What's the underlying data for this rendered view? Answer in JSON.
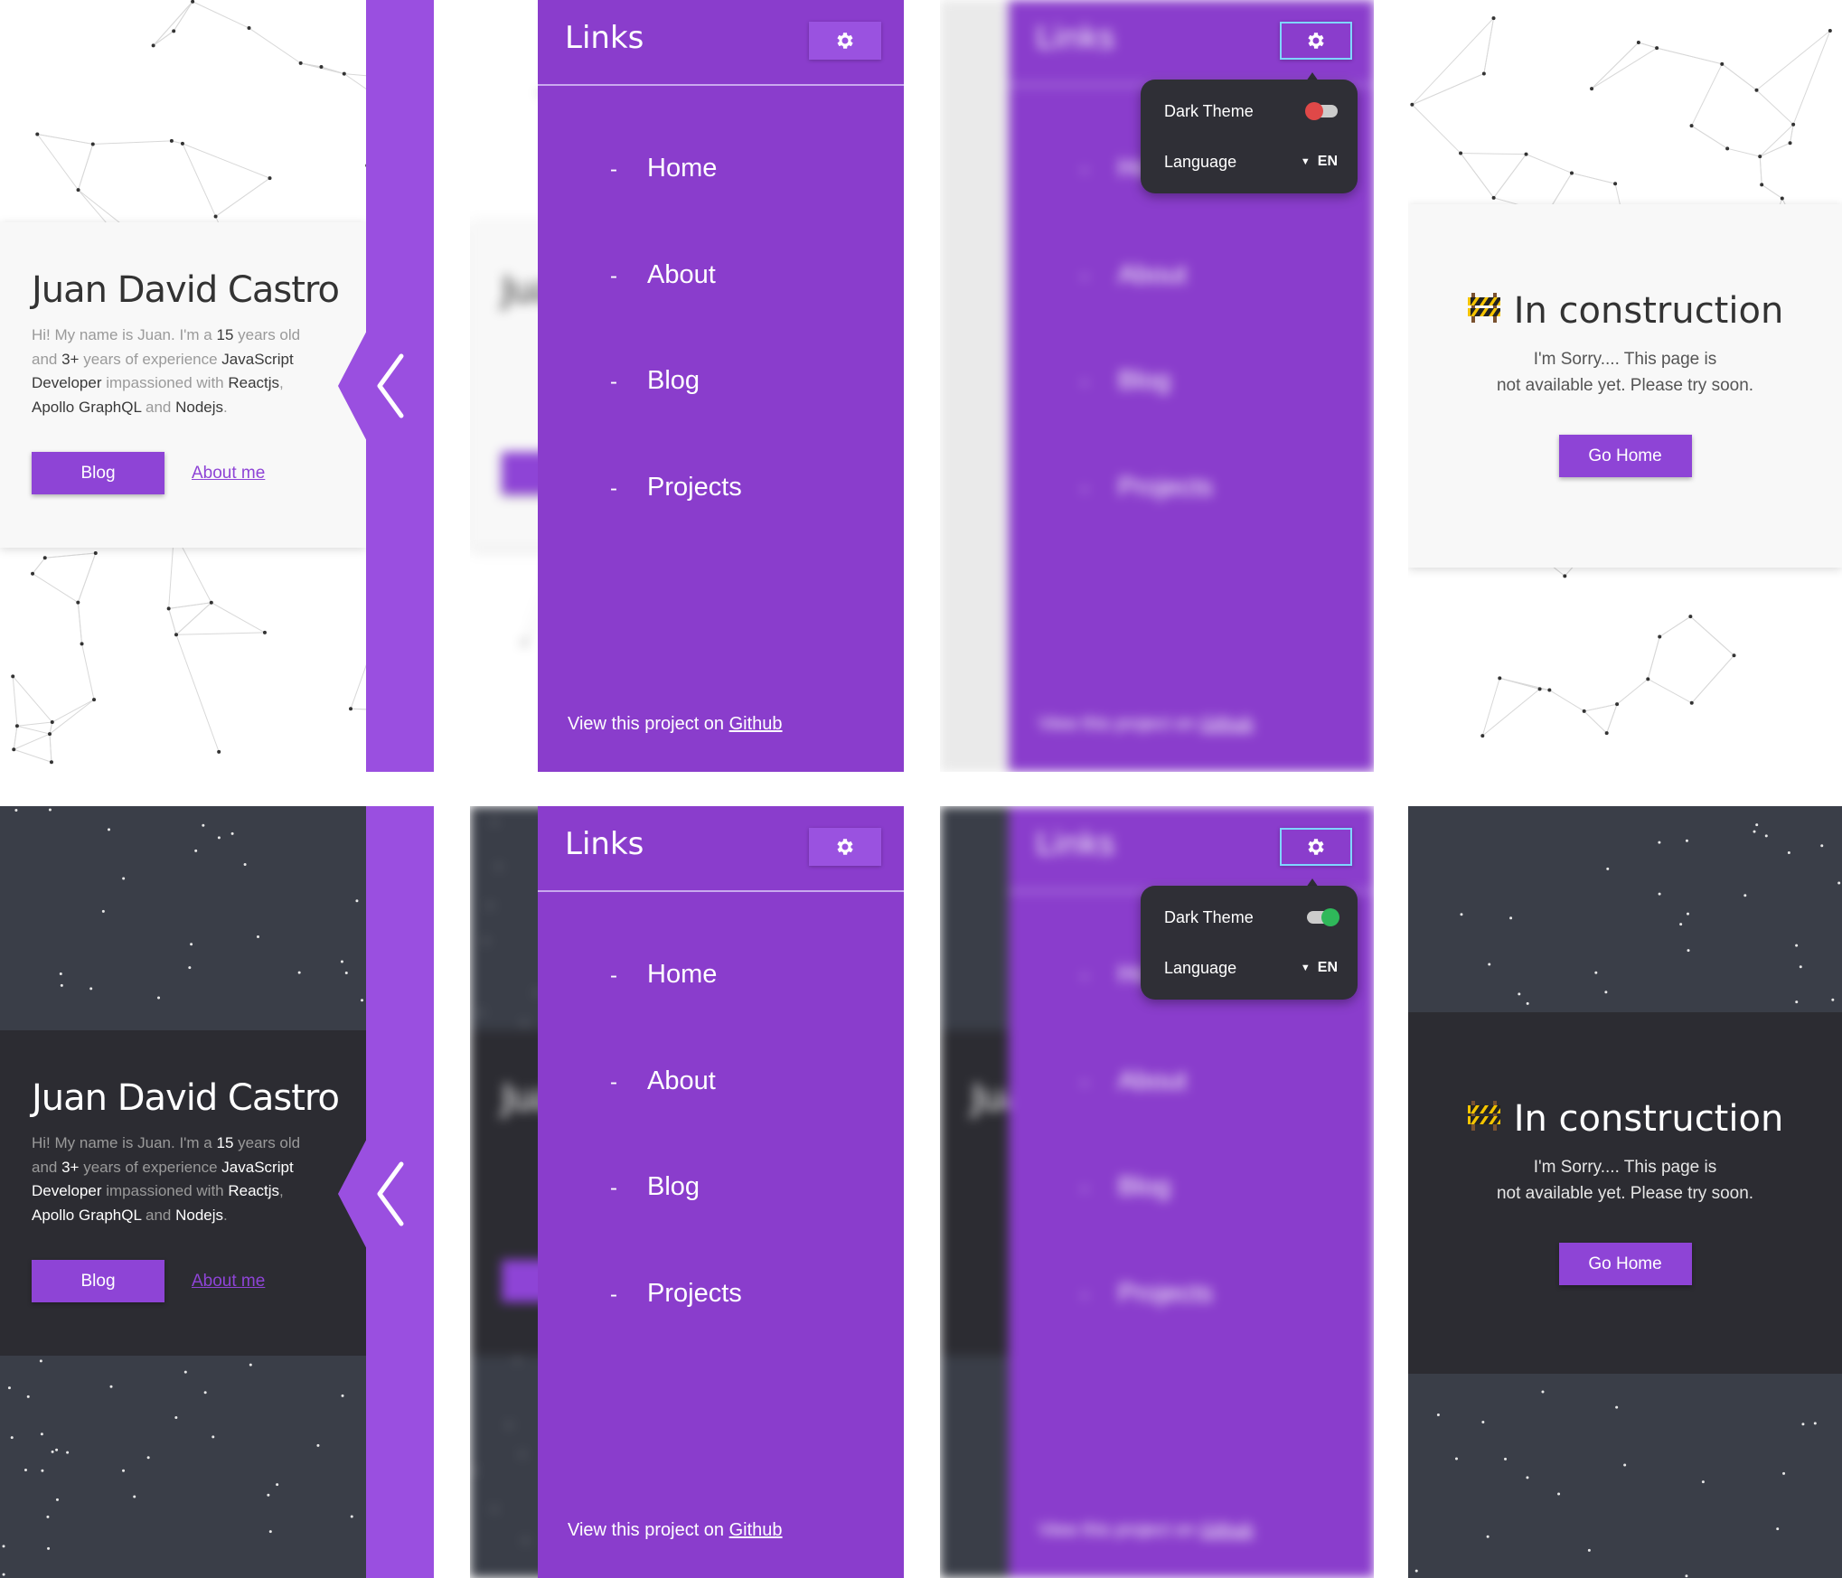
{
  "home": {
    "name": "Juan David Castro",
    "bio": {
      "p1": "Hi! My name is Juan. I'm a ",
      "age": "15",
      "p2": " years old and ",
      "exp": "3+",
      "p3": " years of experience ",
      "role": "JavaScript Developer",
      "p4": " impassioned with ",
      "t1": "Reactjs",
      "p5": ", ",
      "t2": "Apollo GraphQL",
      "p6": " and ",
      "t3": "Nodejs",
      "p7": "."
    },
    "blog_button": "Blog",
    "about_link": "About me"
  },
  "drawer": {
    "title": "Links",
    "dash": "-",
    "items": [
      "Home",
      "About",
      "Blog",
      "Projects"
    ],
    "footer_text": "View this project on ",
    "footer_link": "Github"
  },
  "settings": {
    "dark_theme_label": "Dark Theme",
    "language_label": "Language",
    "language_value": "EN"
  },
  "construction": {
    "title": "In construction",
    "line1": "I'm Sorry.... This page is",
    "line2": "not available yet. Please try soon.",
    "button": "Go Home"
  },
  "icons": {
    "gear": "gear-icon",
    "back": "chevron-left-icon",
    "construction": "construction-icon"
  },
  "colors": {
    "accent": "#8e44d6",
    "drawer": "#8a3dcc",
    "dark_bg": "#3a3e48",
    "dark_card": "#2c2c32",
    "toggle_off": "#e04848",
    "toggle_on": "#2fb85a"
  }
}
